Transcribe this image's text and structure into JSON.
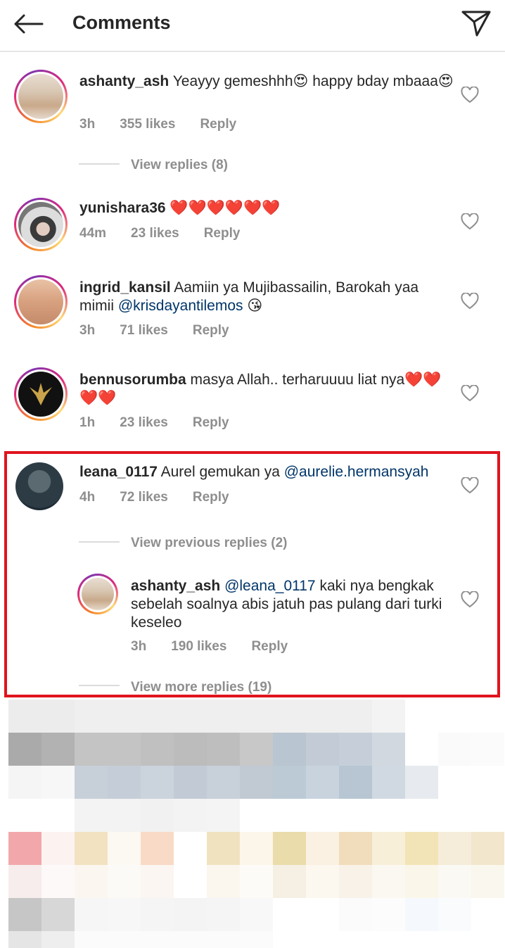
{
  "header": {
    "title": "Comments"
  },
  "comments": [
    {
      "username": "ashanty_ash",
      "text": " Yeayyy gemeshhh😍 happy bday mbaaa😍",
      "time": "3h",
      "likes": "355 likes",
      "reply": "Reply",
      "view_replies": "View replies (8)"
    },
    {
      "username": "yunishara36",
      "text": " ❤️❤️❤️❤️❤️❤️",
      "time": "44m",
      "likes": "23 likes",
      "reply": "Reply"
    },
    {
      "username": "ingrid_kansil",
      "text": " Aamiin ya Mujibassailin, Barokah yaa mimii ",
      "mention": "@krisdayantilemos",
      "emoji": " 😘",
      "time": "3h",
      "likes": "71 likes",
      "reply": "Reply"
    },
    {
      "username": "bennusorumba",
      "text": " masya Allah.. terharuuuu liat nya❤️❤️❤️❤️",
      "time": "1h",
      "likes": "23 likes",
      "reply": "Reply"
    },
    {
      "username": "leana_0117",
      "text": " Aurel gemukan ya ",
      "mention": "@aurelie.hermansyah",
      "time": "4h",
      "likes": "72 likes",
      "reply": "Reply",
      "view_previous": "View previous replies (2)",
      "view_more": "View more replies (19)"
    }
  ],
  "reply": {
    "username": "ashanty_ash",
    "mention": "@leana_0117",
    "text": " kaki nya bengkak sebelah soalnya abis jatuh pas pulang dari turki keseleo",
    "time": "3h",
    "likes": "190 likes",
    "reply": "Reply"
  },
  "colors": {
    "highlight": "#e0141e",
    "mention": "#003569",
    "meta": "#8e8e8e"
  }
}
